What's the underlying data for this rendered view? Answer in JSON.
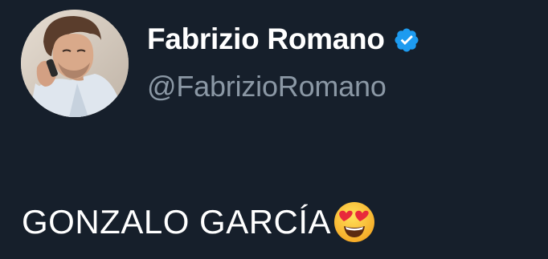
{
  "author": {
    "display_name": "Fabrizio Romano",
    "handle": "@FabrizioRomano",
    "verified": true,
    "avatar_icon": "profile-photo"
  },
  "tweet": {
    "text": "GONZALO GARCÍA",
    "emoji": "heart-eyes-emoji"
  },
  "colors": {
    "background": "#161f2b",
    "name": "#ffffff",
    "handle": "#8b98a5",
    "verified_badge": "#1d9bf0"
  }
}
